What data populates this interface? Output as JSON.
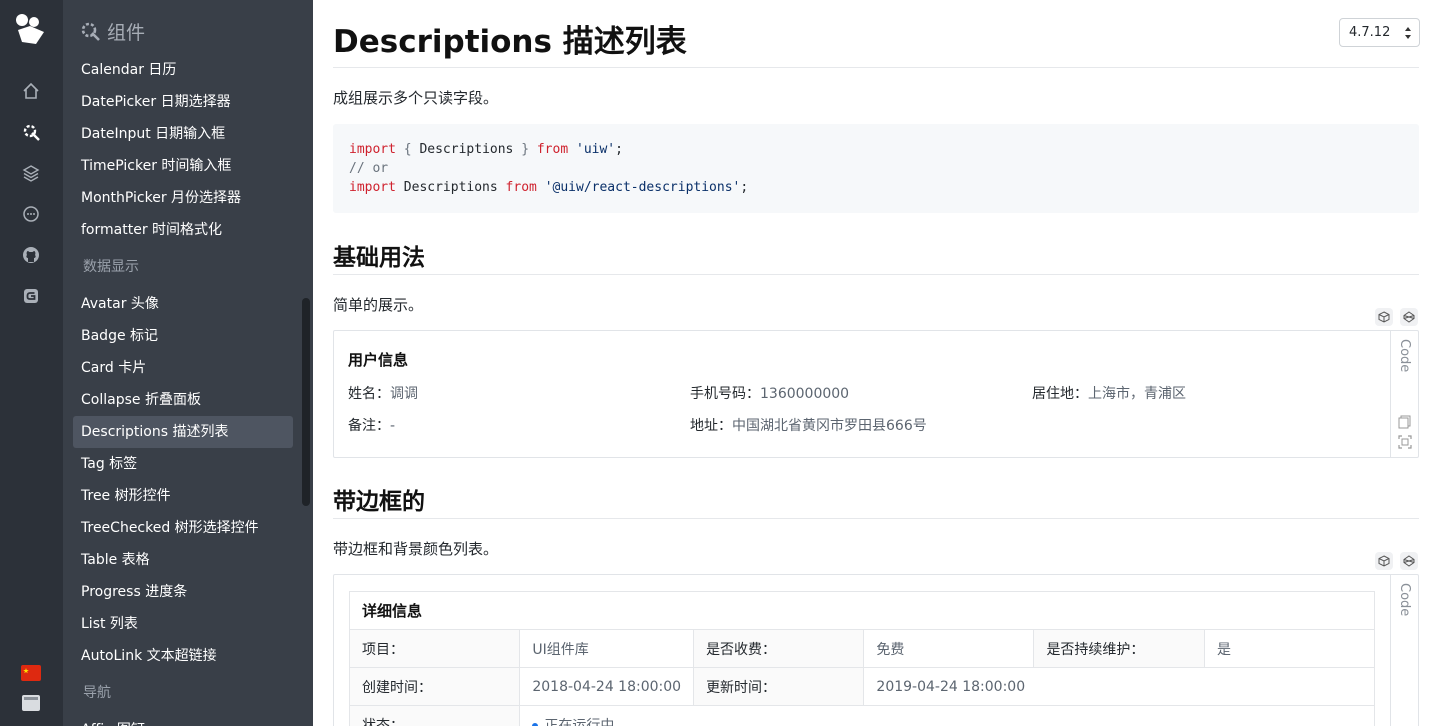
{
  "rail": {
    "icons": [
      "logo-icon",
      "home-icon",
      "components-icon",
      "layers-icon",
      "chat-icon",
      "github-icon",
      "gitee-icon",
      "china-flag-icon",
      "panel-icon"
    ]
  },
  "sidebar": {
    "header": "组件",
    "items": [
      {
        "label": "Calendar 日历",
        "type": "item"
      },
      {
        "label": "DatePicker 日期选择器",
        "type": "item"
      },
      {
        "label": "DateInput 日期输入框",
        "type": "item"
      },
      {
        "label": "TimePicker 时间输入框",
        "type": "item"
      },
      {
        "label": "MonthPicker 月份选择器",
        "type": "item"
      },
      {
        "label": "formatter 时间格式化",
        "type": "item"
      },
      {
        "label": "数据显示",
        "type": "group"
      },
      {
        "label": "Avatar 头像",
        "type": "item"
      },
      {
        "label": "Badge 标记",
        "type": "item"
      },
      {
        "label": "Card 卡片",
        "type": "item"
      },
      {
        "label": "Collapse 折叠面板",
        "type": "item"
      },
      {
        "label": "Descriptions 描述列表",
        "type": "item",
        "active": true
      },
      {
        "label": "Tag 标签",
        "type": "item"
      },
      {
        "label": "Tree 树形控件",
        "type": "item"
      },
      {
        "label": "TreeChecked 树形选择控件",
        "type": "item"
      },
      {
        "label": "Table 表格",
        "type": "item"
      },
      {
        "label": "Progress 进度条",
        "type": "item"
      },
      {
        "label": "List 列表",
        "type": "item"
      },
      {
        "label": "AutoLink 文本超链接",
        "type": "item"
      },
      {
        "label": "导航",
        "type": "group"
      },
      {
        "label": "Affix 图钉",
        "type": "item"
      }
    ]
  },
  "main": {
    "title": "Descriptions 描述列表",
    "version": "4.7.12",
    "intro": "成组展示多个只读字段。",
    "code": {
      "line1": {
        "kw1": "import",
        "punct1": " { ",
        "ident": "Descriptions",
        "punct2": " } ",
        "kw2": "from",
        "sp": " ",
        "str": "'uiw'",
        "end": ";"
      },
      "line2": "// or",
      "line3": {
        "kw1": "import",
        "ident": " Descriptions ",
        "kw2": "from",
        "sp": " ",
        "str": "'@uiw/react-descriptions'",
        "end": ";"
      }
    },
    "section1": {
      "heading": "基础用法",
      "desc": "简单的展示。",
      "code_label": "Code",
      "card_title": "用户信息",
      "fields": [
        {
          "label": "姓名：",
          "value": "调调"
        },
        {
          "label": "手机号码：",
          "value": "1360000000"
        },
        {
          "label": "居住地：",
          "value": "上海市，青浦区"
        },
        {
          "label": "备注：",
          "value": "-"
        },
        {
          "label": "地址：",
          "value": "中国湖北省黄冈市罗田县666号"
        }
      ]
    },
    "section2": {
      "heading": "带边框的",
      "desc": "带边框和背景颜色列表。",
      "code_label": "Code",
      "card_title": "详细信息",
      "rows": [
        [
          {
            "label": "项目：",
            "value": "UI组件库"
          },
          {
            "label": "是否收费：",
            "value": "免费"
          },
          {
            "label": "是否持续维护：",
            "value": "是"
          }
        ],
        [
          {
            "label": "创建时间：",
            "value": "2018-04-24 18:00:00"
          },
          {
            "label": "更新时间：",
            "value": "2019-04-24 18:00:00"
          }
        ],
        [
          {
            "label": "状态：",
            "value": "正在运行中"
          }
        ]
      ]
    }
  }
}
